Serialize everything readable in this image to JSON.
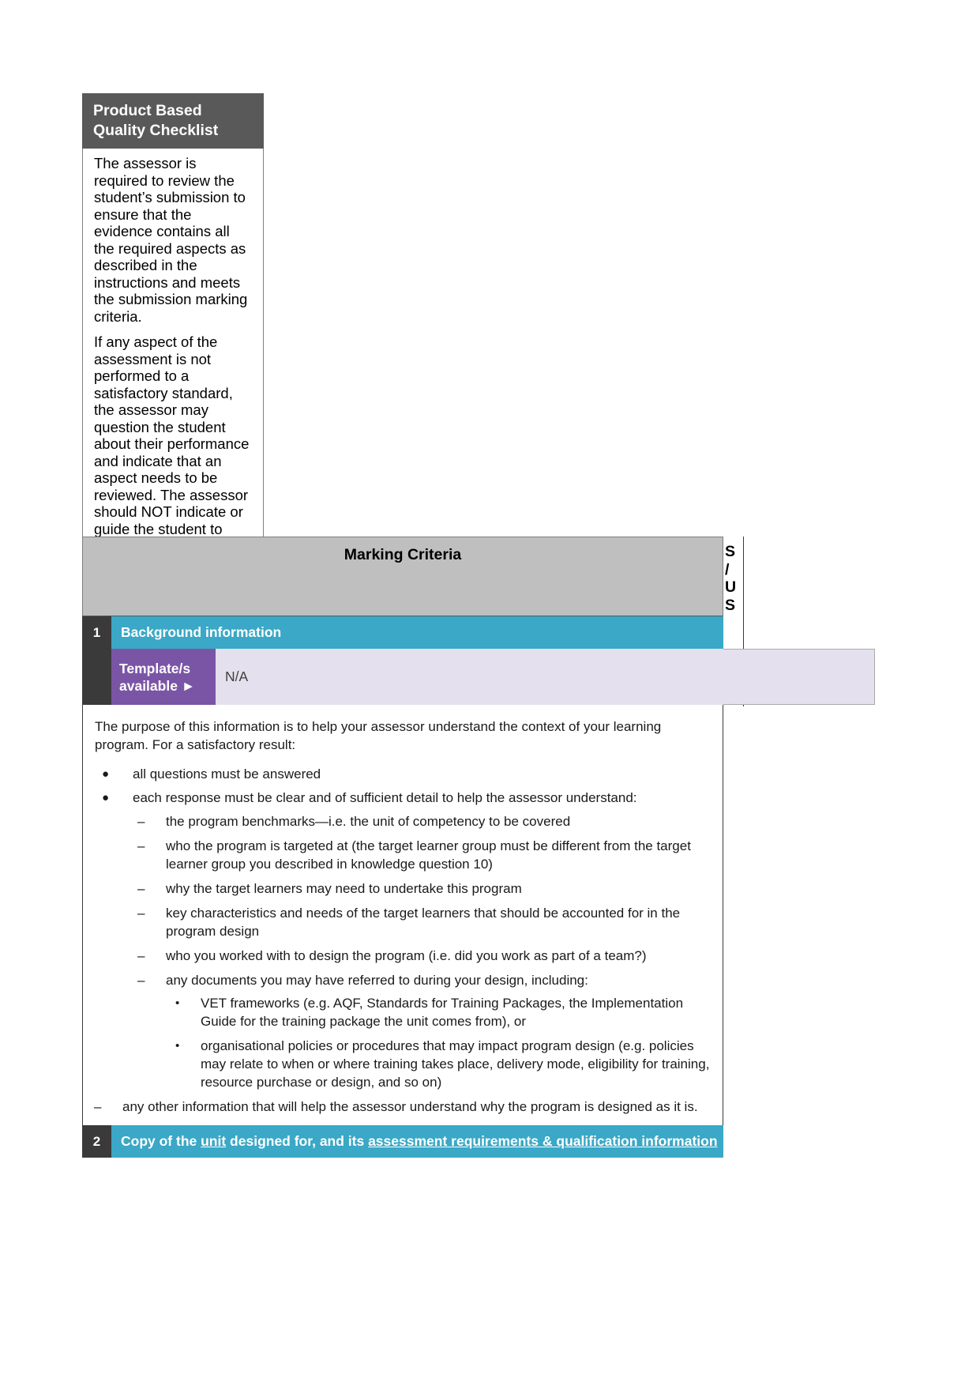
{
  "sidebar": {
    "title": "Product Based Quality Checklist",
    "paragraphs": [
      "The assessor is required to review the student’s submission to ensure that the evidence contains all the required aspects as described in the instructions and meets the submission marking criteria.",
      "If any aspect of the assessment is not performed to a satisfactory standard, the assessor may question the student about their performance and indicate that an aspect needs to be reviewed. The assessor should NOT indicate or guide the student to what needs to be reviewed."
    ]
  },
  "table": {
    "header_title": "Marking Criteria",
    "result_column": {
      "line1": "S",
      "line2": "/",
      "line3": "U",
      "line4": "S"
    },
    "section_1": {
      "number": "1",
      "title": "Background information",
      "template_label_line1": "Template/s",
      "template_label_line2": "available",
      "template_arrow": "►",
      "template_value": "N/A",
      "intro": "The purpose of this information is to help your assessor understand the context of your learning program. For a satisfactory result:",
      "bullets": [
        {
          "marker": "●",
          "text": "all questions must be answered"
        },
        {
          "marker": "●",
          "text": "each response must be clear and of sufficient detail to help the assessor understand:",
          "children": [
            {
              "marker": "–",
              "text": "the program benchmarks—i.e. the unit of competency to be covered"
            },
            {
              "marker": "–",
              "text": "who the program is targeted at (the target learner group must be different from the target learner group you described in knowledge question 10)"
            },
            {
              "marker": "–",
              "text": "why the target learners may need to undertake this program"
            },
            {
              "marker": "–",
              "text": "key characteristics and needs of the target learners that should be accounted for in the program design"
            },
            {
              "marker": "–",
              "text": "who you worked with to design the program (i.e. did you work as part of a team?)"
            },
            {
              "marker": "–",
              "text": "any documents you may have referred to during your design, including:",
              "children": [
                {
                  "marker": "•",
                  "text": "VET frameworks (e.g. AQF, Standards for Training Packages, the Implementation Guide for the training package the unit comes from), or"
                },
                {
                  "marker": "•",
                  "text": "organisational policies or procedures that may impact program design (e.g. policies may relate to when or where training takes place, delivery mode, eligibility for training, resource purchase or design, and so on)"
                }
              ]
            }
          ]
        }
      ],
      "closing_bullet": {
        "marker": "–",
        "text": "any other information that will help the assessor understand why the program is designed as it is."
      }
    },
    "section_2": {
      "number": "2",
      "title_part1": "Copy of the ",
      "title_link1": "unit",
      "title_part2": " designed for, and its ",
      "title_link2": "assessment requirements & qualification information"
    }
  },
  "colors": {
    "header_gray": "#595959",
    "band_gray": "#bfbfbf",
    "teal": "#3aa8c6",
    "purple": "#7a55a5",
    "lavender": "#e5e0ed",
    "number_dark": "#3a3a3a"
  }
}
